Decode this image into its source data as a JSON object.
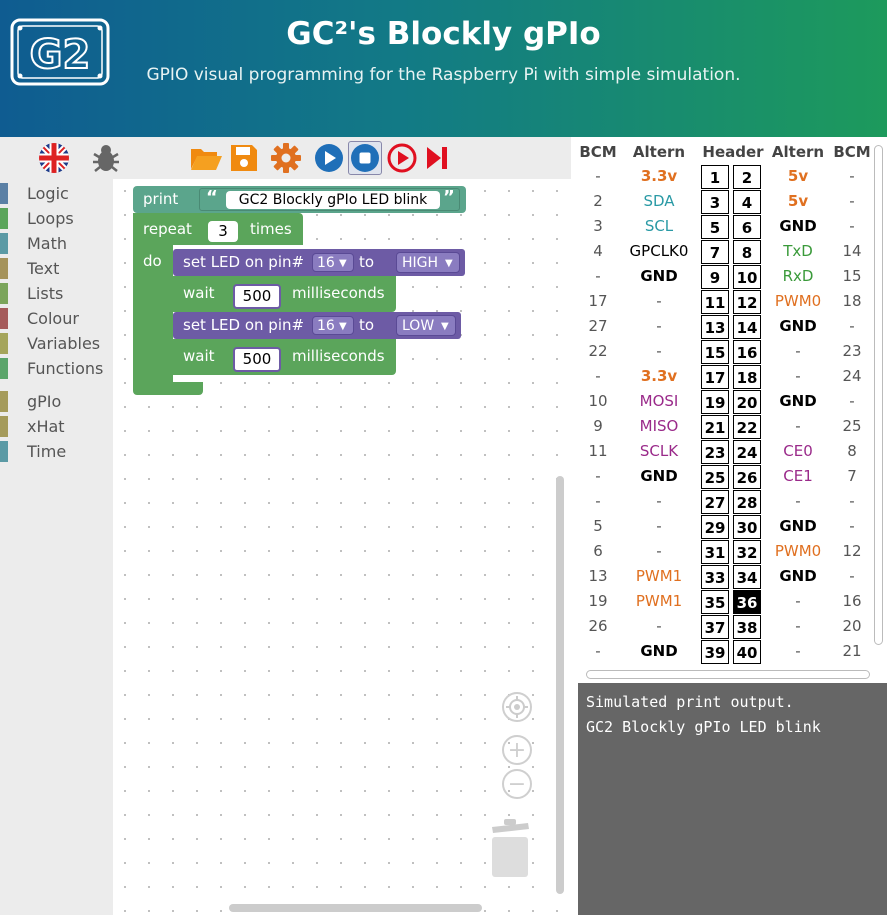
{
  "header": {
    "logo_text": "G2",
    "title": "GC²'s Blockly gPIo",
    "subtitle": "GPIO visual programming for the Raspberry Pi with simple simulation."
  },
  "toolbar": {
    "items": [
      "language-uk-flag-icon",
      "debug-bug-icon",
      "open-folder-icon",
      "save-disk-icon",
      "settings-gear-icon",
      "run-play-icon",
      "stop-icon",
      "run-once-icon",
      "step-icon"
    ]
  },
  "toolbox": {
    "categories": [
      {
        "label": "Logic",
        "color": "#5b80a5"
      },
      {
        "label": "Loops",
        "color": "#5ba55b"
      },
      {
        "label": "Math",
        "color": "#5b9aa5"
      },
      {
        "label": "Text",
        "color": "#a5935b"
      },
      {
        "label": "Lists",
        "color": "#7ba55b"
      },
      {
        "label": "Colour",
        "color": "#a55b5b"
      },
      {
        "label": "Variables",
        "color": "#a5a55b"
      },
      {
        "label": "Functions",
        "color": "#5ba56b"
      }
    ],
    "categories2": [
      {
        "label": "gPIo",
        "color": "#a59b5b"
      },
      {
        "label": "xHat",
        "color": "#a59b5b"
      },
      {
        "label": "Time",
        "color": "#5b9aa5"
      }
    ]
  },
  "blocks": {
    "print_label": "print",
    "print_text": "GC2 Blockly gPIo LED blink",
    "repeat_label": "repeat",
    "repeat_count": "3",
    "times_label": "times",
    "do_label": "do",
    "set_led_label": "set LED on pin#",
    "to_label": "to",
    "set1_pin": "16",
    "set1_value": "HIGH",
    "wait_label": "wait",
    "wait1_ms": "500",
    "ms_label": "milliseconds",
    "set2_pin": "16",
    "set2_value": "LOW",
    "wait2_ms": "500",
    "colors": {
      "text": "#5ba58c",
      "loop": "#5ba55b",
      "gpio": "#6d5ba5",
      "time": "#5ba55b"
    }
  },
  "workspace_controls": [
    "recenter-icon",
    "zoom-in-icon",
    "zoom-out-icon",
    "trash-icon"
  ],
  "pin_table": {
    "headers": [
      "BCM",
      "Altern",
      "Header",
      "Altern",
      "BCM"
    ],
    "rows": [
      {
        "lb": "-",
        "la": "3.3v",
        "lac": "#e07020",
        "lab": true,
        "p1": "1",
        "p2": "2",
        "ra": "5v",
        "rac": "#e07020",
        "rab": true,
        "rb": "-"
      },
      {
        "lb": "2",
        "la": "SDA",
        "lac": "#2a9aa5",
        "lab": false,
        "p1": "3",
        "p2": "4",
        "ra": "5v",
        "rac": "#e07020",
        "rab": true,
        "rb": "-"
      },
      {
        "lb": "3",
        "la": "SCL",
        "lac": "#2a9aa5",
        "lab": false,
        "p1": "5",
        "p2": "6",
        "ra": "GND",
        "rac": "#000000",
        "rab": true,
        "rb": "-"
      },
      {
        "lb": "4",
        "la": "GPCLK0",
        "lac": "#000000",
        "lab": false,
        "p1": "7",
        "p2": "8",
        "ra": "TxD",
        "rac": "#3a9a3a",
        "rab": false,
        "rb": "14"
      },
      {
        "lb": "-",
        "la": "GND",
        "lac": "#000000",
        "lab": true,
        "p1": "9",
        "p2": "10",
        "ra": "RxD",
        "rac": "#3a9a3a",
        "rab": false,
        "rb": "15"
      },
      {
        "lb": "17",
        "la": "-",
        "lac": "#555555",
        "lab": false,
        "p1": "11",
        "p2": "12",
        "ra": "PWM0",
        "rac": "#e07020",
        "rab": false,
        "rb": "18"
      },
      {
        "lb": "27",
        "la": "-",
        "lac": "#555555",
        "lab": false,
        "p1": "13",
        "p2": "14",
        "ra": "GND",
        "rac": "#000000",
        "rab": true,
        "rb": "-"
      },
      {
        "lb": "22",
        "la": "-",
        "lac": "#555555",
        "lab": false,
        "p1": "15",
        "p2": "16",
        "ra": "-",
        "rac": "#555555",
        "rab": false,
        "rb": "23"
      },
      {
        "lb": "-",
        "la": "3.3v",
        "lac": "#e07020",
        "lab": true,
        "p1": "17",
        "p2": "18",
        "ra": "-",
        "rac": "#555555",
        "rab": false,
        "rb": "24"
      },
      {
        "lb": "10",
        "la": "MOSI",
        "lac": "#9a2a8a",
        "lab": false,
        "p1": "19",
        "p2": "20",
        "ra": "GND",
        "rac": "#000000",
        "rab": true,
        "rb": "-"
      },
      {
        "lb": "9",
        "la": "MISO",
        "lac": "#9a2a8a",
        "lab": false,
        "p1": "21",
        "p2": "22",
        "ra": "-",
        "rac": "#555555",
        "rab": false,
        "rb": "25"
      },
      {
        "lb": "11",
        "la": "SCLK",
        "lac": "#9a2a8a",
        "lab": false,
        "p1": "23",
        "p2": "24",
        "ra": "CE0",
        "rac": "#9a2a8a",
        "rab": false,
        "rb": "8"
      },
      {
        "lb": "-",
        "la": "GND",
        "lac": "#000000",
        "lab": true,
        "p1": "25",
        "p2": "26",
        "ra": "CE1",
        "rac": "#9a2a8a",
        "rab": false,
        "rb": "7"
      },
      {
        "lb": "-",
        "la": "-",
        "lac": "#555555",
        "lab": false,
        "p1": "27",
        "p2": "28",
        "ra": "-",
        "rac": "#555555",
        "rab": false,
        "rb": "-"
      },
      {
        "lb": "5",
        "la": "-",
        "lac": "#555555",
        "lab": false,
        "p1": "29",
        "p2": "30",
        "ra": "GND",
        "rac": "#000000",
        "rab": true,
        "rb": "-"
      },
      {
        "lb": "6",
        "la": "-",
        "lac": "#555555",
        "lab": false,
        "p1": "31",
        "p2": "32",
        "ra": "PWM0",
        "rac": "#e07020",
        "rab": false,
        "rb": "12"
      },
      {
        "lb": "13",
        "la": "PWM1",
        "lac": "#e07020",
        "lab": false,
        "p1": "33",
        "p2": "34",
        "ra": "GND",
        "rac": "#000000",
        "rab": true,
        "rb": "-"
      },
      {
        "lb": "19",
        "la": "PWM1",
        "lac": "#e07020",
        "lab": false,
        "p1": "35",
        "p2": "36",
        "ra": "-",
        "rac": "#555555",
        "rab": false,
        "rb": "16"
      },
      {
        "lb": "26",
        "la": "-",
        "lac": "#555555",
        "lab": false,
        "p1": "37",
        "p2": "38",
        "ra": "-",
        "rac": "#555555",
        "rab": false,
        "rb": "20"
      },
      {
        "lb": "-",
        "la": "GND",
        "lac": "#000000",
        "lab": true,
        "p1": "39",
        "p2": "40",
        "ra": "-",
        "rac": "#555555",
        "rab": false,
        "rb": "21"
      }
    ],
    "active_pin": "36"
  },
  "output": {
    "lines": [
      "Simulated print output.",
      "GC2 Blockly gPIo LED blink"
    ]
  }
}
